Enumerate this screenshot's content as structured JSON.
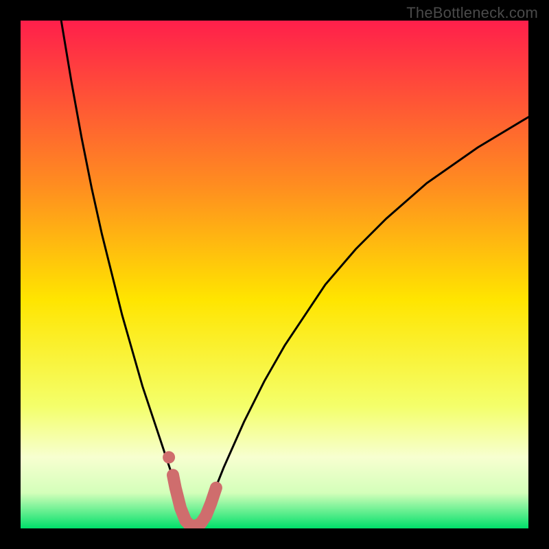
{
  "watermark": "TheBottleneck.com",
  "colors": {
    "background": "#000000",
    "watermark_text": "#4a4a4a",
    "gradient_top": "#ff1f4b",
    "gradient_upper_mid": "#ff9a1a",
    "gradient_mid": "#ffe500",
    "gradient_lower_mid": "#f4ff6b",
    "gradient_pale": "#f7ffd0",
    "gradient_bottom": "#00e06a",
    "curve_stroke": "#000000",
    "marker_stroke": "#cf6d6d",
    "marker_fill": "#cf6d6d"
  },
  "chart_data": {
    "type": "line",
    "title": "",
    "xlabel": "",
    "ylabel": "",
    "xlim": [
      0,
      100
    ],
    "ylim": [
      0,
      100
    ],
    "grid": false,
    "curve": {
      "comment": "Bottleneck percentage vs component balance index; 0 at optimum ~34, rises steeply to both sides",
      "x": [
        8,
        10,
        12,
        14,
        16,
        18,
        20,
        22,
        24,
        26,
        28,
        30,
        32,
        33,
        34,
        35,
        36,
        38,
        40,
        44,
        48,
        52,
        56,
        60,
        66,
        72,
        80,
        90,
        100
      ],
      "y": [
        100,
        88,
        77,
        67,
        58,
        50,
        42,
        35,
        28,
        22,
        16,
        10,
        5,
        2,
        0,
        1,
        3,
        7,
        12,
        21,
        29,
        36,
        42,
        48,
        55,
        61,
        68,
        75,
        81
      ]
    },
    "optimum_markers": {
      "comment": "Highlighted salmon arc around the minimum",
      "points": [
        {
          "x": 30.0,
          "y": 10.5
        },
        {
          "x": 30.5,
          "y": 8.0
        },
        {
          "x": 31.5,
          "y": 4.0
        },
        {
          "x": 32.5,
          "y": 1.5
        },
        {
          "x": 33.5,
          "y": 0.5
        },
        {
          "x": 34.5,
          "y": 0.5
        },
        {
          "x": 35.5,
          "y": 1.0
        },
        {
          "x": 36.5,
          "y": 2.5
        },
        {
          "x": 37.5,
          "y": 5.0
        },
        {
          "x": 38.5,
          "y": 8.0
        }
      ],
      "lonely_point": {
        "x": 29.2,
        "y": 14.0
      }
    }
  }
}
